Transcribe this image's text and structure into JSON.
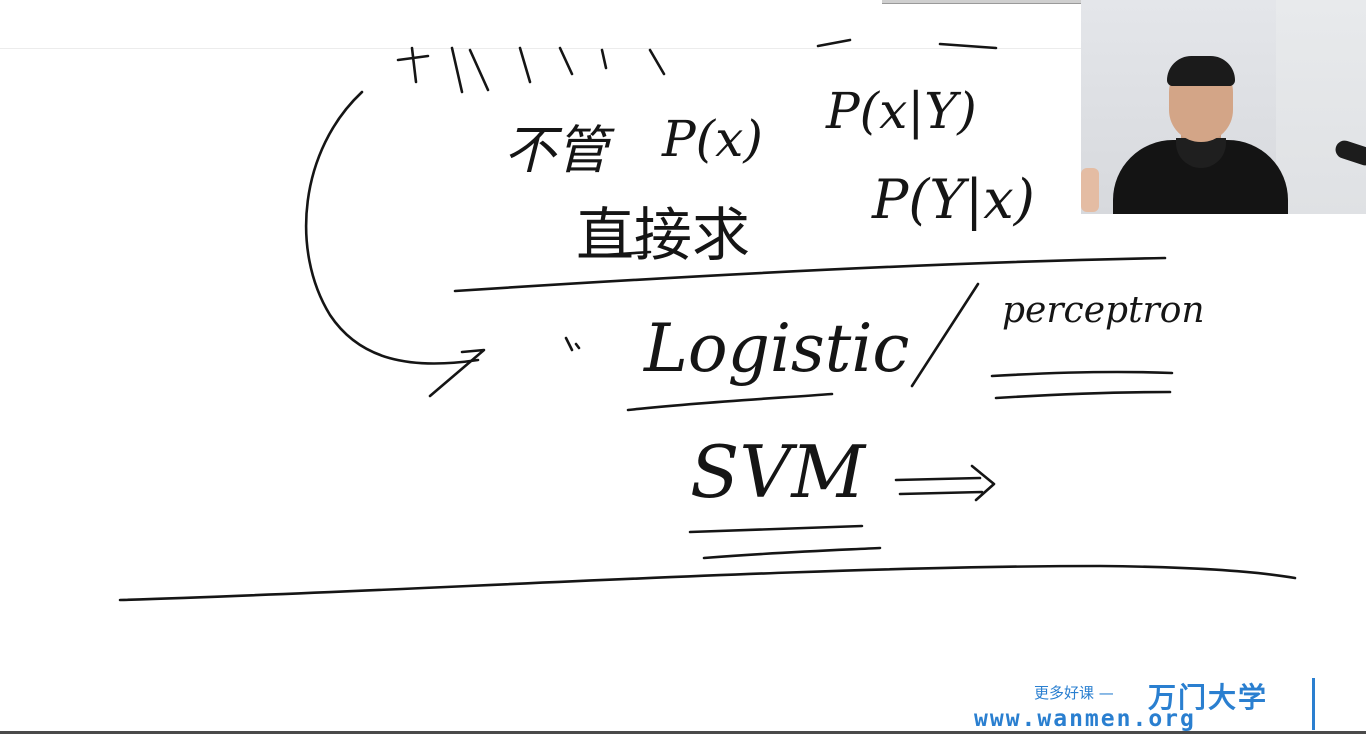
{
  "whiteboard": {
    "line_partial": "判别式",
    "line_no_model": "不管",
    "term_px": "P(x)",
    "term_pxy": "P(x|Y)",
    "line_direct": "直接求",
    "term_pyx": "P(Y|x)",
    "model_logistic": "Logistic",
    "separator": "/",
    "model_perceptron": "perceptron",
    "model_svm": "SVM"
  },
  "webcam": {
    "subject": "instructor",
    "background_color": "#e2e4e8"
  },
  "watermark": {
    "slogan": "更多好课 —",
    "brand": "万门大学",
    "url": "www.wanmen.org",
    "color": "#2a7fd0"
  },
  "colors": {
    "ink": "#151515",
    "board": "#ffffff"
  }
}
